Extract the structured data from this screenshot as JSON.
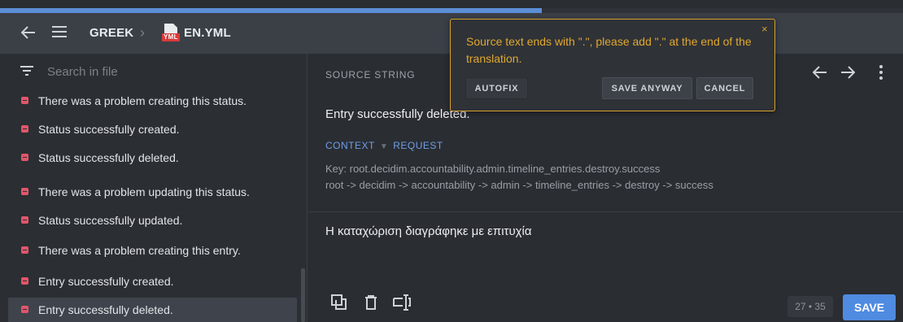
{
  "progress": {
    "fraction": 0.6
  },
  "breadcrumb": {
    "project": "GREEK",
    "file": "EN.YML",
    "file_badge": "YML"
  },
  "search": {
    "placeholder": "Search in file"
  },
  "list": {
    "items": [
      {
        "label": "There was a problem creating this status."
      },
      {
        "label": "Status successfully created."
      },
      {
        "label": "Status successfully deleted."
      },
      {
        "label": "There was a problem updating this status."
      },
      {
        "label": "Status successfully updated."
      },
      {
        "label": "There was a problem creating this entry."
      },
      {
        "label": "Entry successfully created."
      },
      {
        "label": "Entry successfully deleted."
      }
    ],
    "active_index": 7
  },
  "main": {
    "section_label": "SOURCE STRING",
    "source_text": "Entry successfully deleted.",
    "context_label": "CONTEXT",
    "request_label": "REQUEST",
    "key_line": "Key: root.decidim.accountability.admin.timeline_entries.destroy.success",
    "path_line": "root -> decidim -> accountability -> admin -> timeline_entries -> destroy -> success",
    "translation": "Η καταχώριση διαγράφηκε με επιτυχία",
    "counter": "27 • 35",
    "save_label": "SAVE"
  },
  "popup": {
    "message": "Source text ends with \".\", please add \".\" at the end of the translation.",
    "close": "×",
    "autofix": "AUTOFIX",
    "save_anyway": "SAVE ANYWAY",
    "cancel": "CANCEL"
  },
  "colors": {
    "accent": "#4f8be0",
    "warning": "#d6a12a",
    "status_dot": "#e0566a"
  }
}
